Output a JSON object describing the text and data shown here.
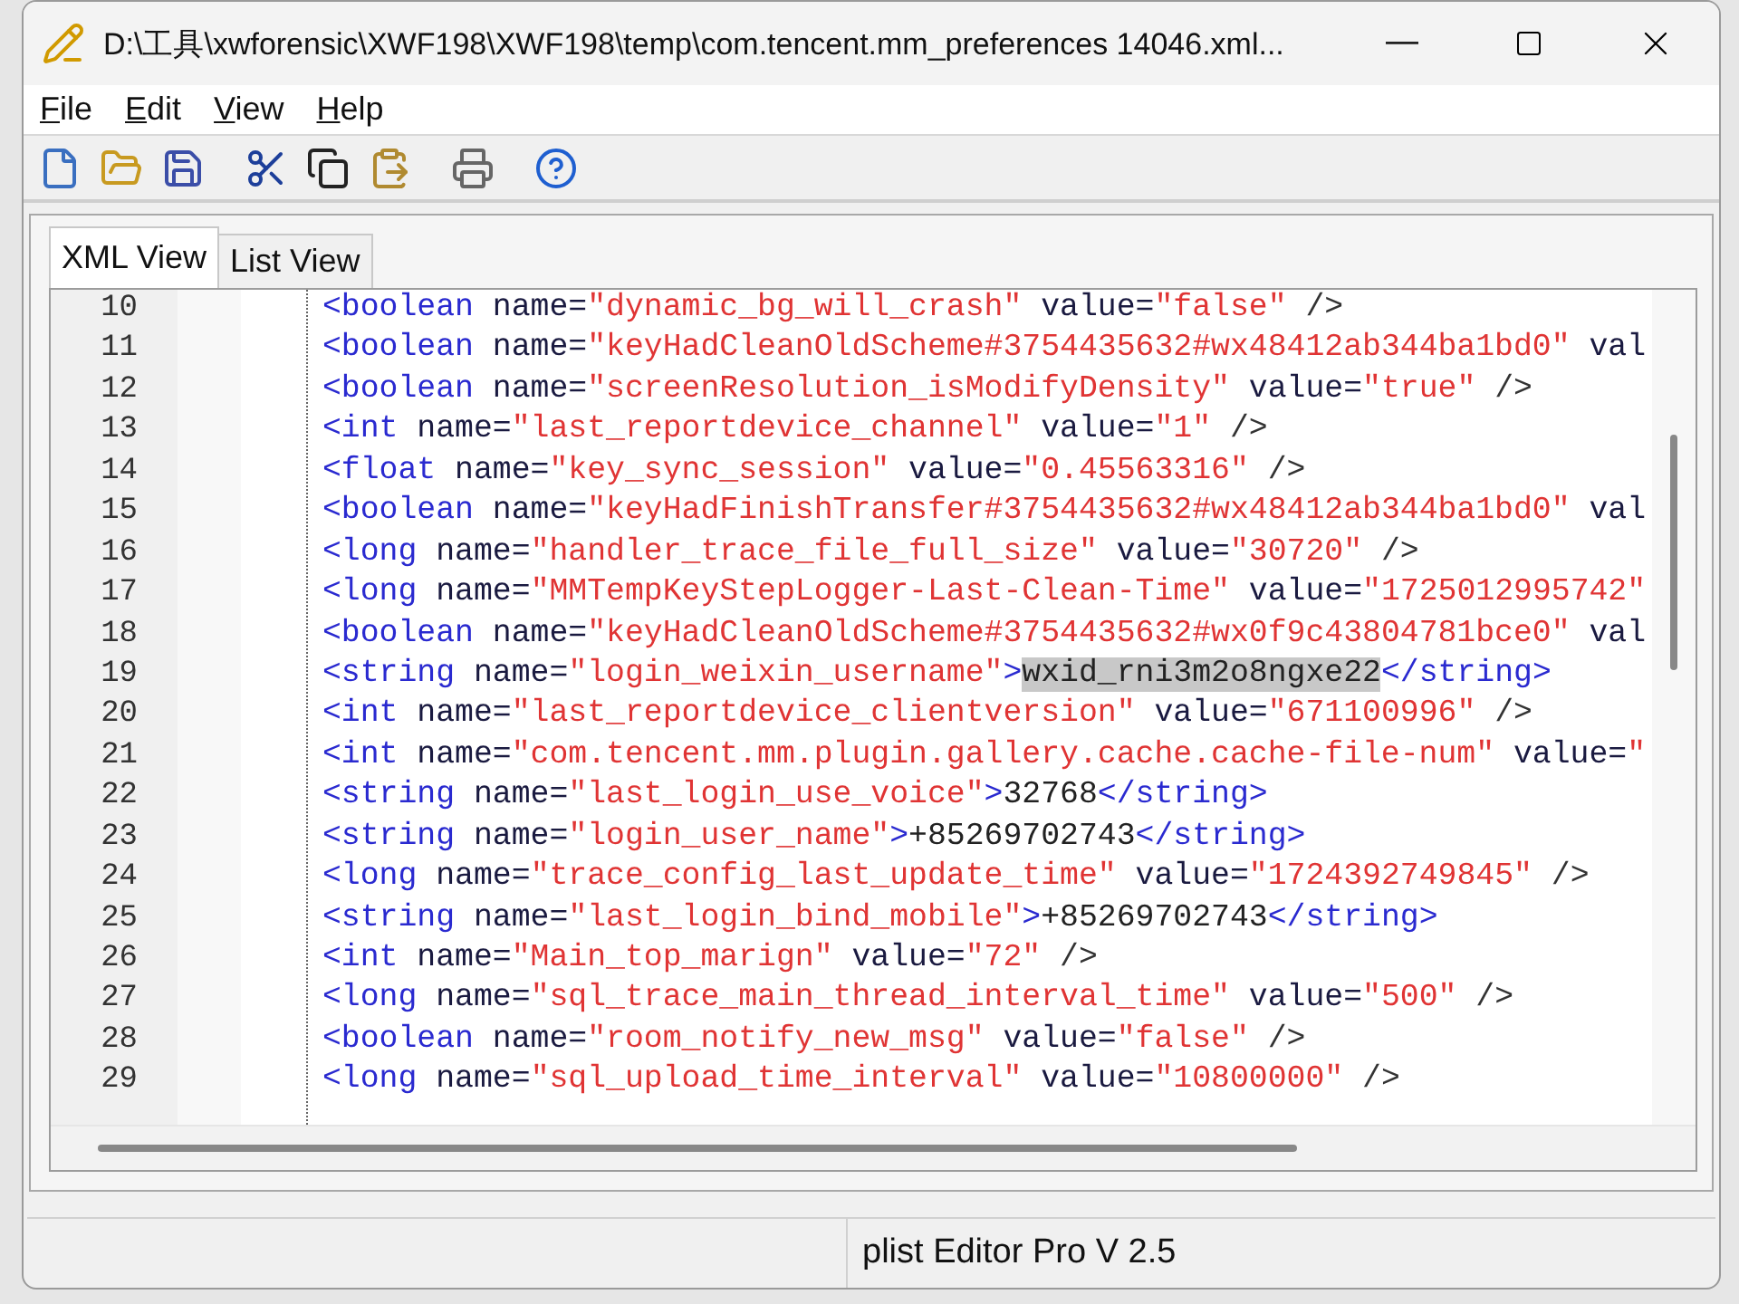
{
  "window": {
    "title": "D:\\工具\\xwforensic\\XWF198\\XWF198\\temp\\com.tencent.mm_preferences 14046.xml..."
  },
  "menu": [
    "File",
    "Edit",
    "View",
    "Help"
  ],
  "tabs": [
    {
      "label": "XML View",
      "selected": true
    },
    {
      "label": "List View",
      "selected": false
    }
  ],
  "editor": {
    "lines": [
      {
        "number": "10",
        "tokens": [
          {
            "kind": "tag",
            "text": "<boolean"
          },
          {
            "kind": "attr",
            "text": " name="
          },
          {
            "kind": "value",
            "text": "\"dynamic_bg_will_crash\""
          },
          {
            "kind": "attr",
            "text": " value="
          },
          {
            "kind": "value",
            "text": "\"false\""
          },
          {
            "kind": "punct",
            "text": " />"
          }
        ]
      },
      {
        "number": "11",
        "tokens": [
          {
            "kind": "tag",
            "text": "<boolean"
          },
          {
            "kind": "attr",
            "text": " name="
          },
          {
            "kind": "value",
            "text": "\"keyHadCleanOldScheme#3754435632#wx48412ab344ba1bd0\""
          },
          {
            "kind": "attr",
            "text": " val"
          }
        ]
      },
      {
        "number": "12",
        "tokens": [
          {
            "kind": "tag",
            "text": "<boolean"
          },
          {
            "kind": "attr",
            "text": " name="
          },
          {
            "kind": "value",
            "text": "\"screenResolution_isModifyDensity\""
          },
          {
            "kind": "attr",
            "text": " value="
          },
          {
            "kind": "value",
            "text": "\"true\""
          },
          {
            "kind": "punct",
            "text": " />"
          }
        ]
      },
      {
        "number": "13",
        "tokens": [
          {
            "kind": "tag",
            "text": "<int"
          },
          {
            "kind": "attr",
            "text": " name="
          },
          {
            "kind": "value",
            "text": "\"last_reportdevice_channel\""
          },
          {
            "kind": "attr",
            "text": " value="
          },
          {
            "kind": "value",
            "text": "\"1\""
          },
          {
            "kind": "punct",
            "text": " />"
          }
        ]
      },
      {
        "number": "14",
        "tokens": [
          {
            "kind": "tag",
            "text": "<float"
          },
          {
            "kind": "attr",
            "text": " name="
          },
          {
            "kind": "value",
            "text": "\"key_sync_session\""
          },
          {
            "kind": "attr",
            "text": " value="
          },
          {
            "kind": "value",
            "text": "\"0.45563316\""
          },
          {
            "kind": "punct",
            "text": " />"
          }
        ]
      },
      {
        "number": "15",
        "tokens": [
          {
            "kind": "tag",
            "text": "<boolean"
          },
          {
            "kind": "attr",
            "text": " name="
          },
          {
            "kind": "value",
            "text": "\"keyHadFinishTransfer#3754435632#wx48412ab344ba1bd0\""
          },
          {
            "kind": "attr",
            "text": " val"
          }
        ]
      },
      {
        "number": "16",
        "tokens": [
          {
            "kind": "tag",
            "text": "<long"
          },
          {
            "kind": "attr",
            "text": " name="
          },
          {
            "kind": "value",
            "text": "\"handler_trace_file_full_size\""
          },
          {
            "kind": "attr",
            "text": " value="
          },
          {
            "kind": "value",
            "text": "\"30720\""
          },
          {
            "kind": "punct",
            "text": " />"
          }
        ]
      },
      {
        "number": "17",
        "tokens": [
          {
            "kind": "tag",
            "text": "<long"
          },
          {
            "kind": "attr",
            "text": " name="
          },
          {
            "kind": "value",
            "text": "\"MMTempKeyStepLogger-Last-Clean-Time\""
          },
          {
            "kind": "attr",
            "text": " value="
          },
          {
            "kind": "value",
            "text": "\"1725012995742\""
          }
        ]
      },
      {
        "number": "18",
        "tokens": [
          {
            "kind": "tag",
            "text": "<boolean"
          },
          {
            "kind": "attr",
            "text": " name="
          },
          {
            "kind": "value",
            "text": "\"keyHadCleanOldScheme#3754435632#wx0f9c43804781bce0\""
          },
          {
            "kind": "attr",
            "text": " val"
          }
        ]
      },
      {
        "number": "19",
        "tokens": [
          {
            "kind": "tag",
            "text": "<string"
          },
          {
            "kind": "attr",
            "text": " name="
          },
          {
            "kind": "value",
            "text": "\"login_weixin_username\""
          },
          {
            "kind": "tag",
            "text": ">"
          },
          {
            "kind": "text",
            "text": "wxid_rni3m2o8ngxe22",
            "selected": true
          },
          {
            "kind": "tag",
            "text": "</string>"
          }
        ]
      },
      {
        "number": "20",
        "tokens": [
          {
            "kind": "tag",
            "text": "<int"
          },
          {
            "kind": "attr",
            "text": " name="
          },
          {
            "kind": "value",
            "text": "\"last_reportdevice_clientversion\""
          },
          {
            "kind": "attr",
            "text": " value="
          },
          {
            "kind": "value",
            "text": "\"671100996\""
          },
          {
            "kind": "punct",
            "text": " />"
          }
        ]
      },
      {
        "number": "21",
        "tokens": [
          {
            "kind": "tag",
            "text": "<int"
          },
          {
            "kind": "attr",
            "text": " name="
          },
          {
            "kind": "value",
            "text": "\"com.tencent.mm.plugin.gallery.cache.cache-file-num\""
          },
          {
            "kind": "attr",
            "text": " value="
          },
          {
            "kind": "value",
            "text": "\""
          }
        ]
      },
      {
        "number": "22",
        "tokens": [
          {
            "kind": "tag",
            "text": "<string"
          },
          {
            "kind": "attr",
            "text": " name="
          },
          {
            "kind": "value",
            "text": "\"last_login_use_voice\""
          },
          {
            "kind": "tag",
            "text": ">"
          },
          {
            "kind": "text",
            "text": "32768",
            "selected": false
          },
          {
            "kind": "tag",
            "text": "</string>"
          }
        ]
      },
      {
        "number": "23",
        "tokens": [
          {
            "kind": "tag",
            "text": "<string"
          },
          {
            "kind": "attr",
            "text": " name="
          },
          {
            "kind": "value",
            "text": "\"login_user_name\""
          },
          {
            "kind": "tag",
            "text": ">"
          },
          {
            "kind": "text",
            "text": "+85269702743",
            "selected": false
          },
          {
            "kind": "tag",
            "text": "</string>"
          }
        ]
      },
      {
        "number": "24",
        "tokens": [
          {
            "kind": "tag",
            "text": "<long"
          },
          {
            "kind": "attr",
            "text": " name="
          },
          {
            "kind": "value",
            "text": "\"trace_config_last_update_time\""
          },
          {
            "kind": "attr",
            "text": " value="
          },
          {
            "kind": "value",
            "text": "\"1724392749845\""
          },
          {
            "kind": "punct",
            "text": " />"
          }
        ]
      },
      {
        "number": "25",
        "tokens": [
          {
            "kind": "tag",
            "text": "<string"
          },
          {
            "kind": "attr",
            "text": " name="
          },
          {
            "kind": "value",
            "text": "\"last_login_bind_mobile\""
          },
          {
            "kind": "tag",
            "text": ">"
          },
          {
            "kind": "text",
            "text": "+85269702743",
            "selected": false
          },
          {
            "kind": "tag",
            "text": "</string>"
          }
        ]
      },
      {
        "number": "26",
        "tokens": [
          {
            "kind": "tag",
            "text": "<int"
          },
          {
            "kind": "attr",
            "text": " name="
          },
          {
            "kind": "value",
            "text": "\"Main_top_marign\""
          },
          {
            "kind": "attr",
            "text": " value="
          },
          {
            "kind": "value",
            "text": "\"72\""
          },
          {
            "kind": "punct",
            "text": " />"
          }
        ]
      },
      {
        "number": "27",
        "tokens": [
          {
            "kind": "tag",
            "text": "<long"
          },
          {
            "kind": "attr",
            "text": " name="
          },
          {
            "kind": "value",
            "text": "\"sql_trace_main_thread_interval_time\""
          },
          {
            "kind": "attr",
            "text": " value="
          },
          {
            "kind": "value",
            "text": "\"500\""
          },
          {
            "kind": "punct",
            "text": " />"
          }
        ]
      },
      {
        "number": "28",
        "tokens": [
          {
            "kind": "tag",
            "text": "<boolean"
          },
          {
            "kind": "attr",
            "text": " name="
          },
          {
            "kind": "value",
            "text": "\"room_notify_new_msg\""
          },
          {
            "kind": "attr",
            "text": " value="
          },
          {
            "kind": "value",
            "text": "\"false\""
          },
          {
            "kind": "punct",
            "text": " />"
          }
        ]
      },
      {
        "number": "29",
        "tokens": [
          {
            "kind": "tag",
            "text": "<long"
          },
          {
            "kind": "attr",
            "text": " name="
          },
          {
            "kind": "value",
            "text": "\"sql_upload_time_interval\""
          },
          {
            "kind": "attr",
            "text": " value="
          },
          {
            "kind": "value",
            "text": "\"10800000\""
          },
          {
            "kind": "punct",
            "text": " />"
          }
        ]
      }
    ]
  },
  "status_bar": {
    "text": "plist Editor Pro V 2.5"
  }
}
